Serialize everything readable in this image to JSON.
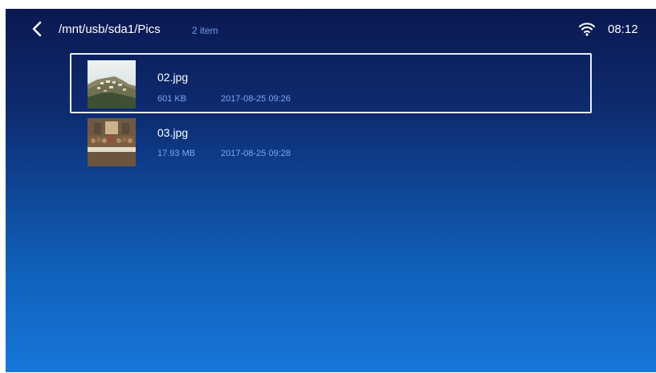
{
  "header": {
    "path": "/mnt/usb/sda1/Pics",
    "item_count": "2 item",
    "time": "08:12",
    "back_icon": "chevron-left-icon",
    "status_icon": "wifi-icon"
  },
  "files": [
    {
      "name": "02.jpg",
      "size": "601 KB",
      "date": "2017-08-25 09:26",
      "thumbnail": "hillside-town-thumbnail",
      "selected": true
    },
    {
      "name": "03.jpg",
      "size": "17.93 MB",
      "date": "2017-08-25 09:28",
      "thumbnail": "painting-thumbnail",
      "selected": false
    }
  ],
  "colors": {
    "background_top": "#0b1850",
    "background_bottom": "#1677d9",
    "secondary_text": "#79a7ee",
    "selection_border": "#e8eef9"
  }
}
